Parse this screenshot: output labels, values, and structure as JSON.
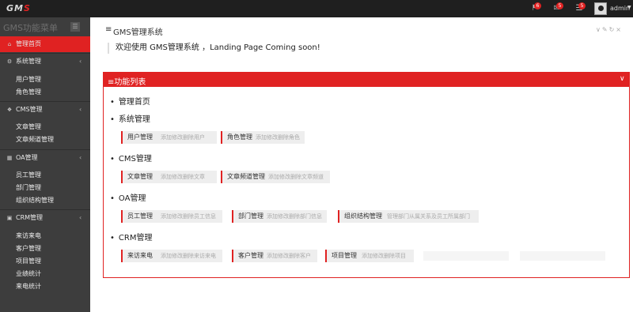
{
  "topbar": {
    "logo_main": "GM",
    "logo_accent": "S",
    "badges": [
      "6",
      "5",
      "5"
    ],
    "username": "admin"
  },
  "sidebar": {
    "menu_title": "GMS功能菜单",
    "home": "管理首页",
    "sections": [
      {
        "label": "系统管理",
        "items": [
          "用户管理",
          "角色管理"
        ]
      },
      {
        "label": "CMS管理",
        "items": [
          "文章管理",
          "文章频道管理"
        ]
      },
      {
        "label": "OA管理",
        "items": [
          "员工管理",
          "部门管理",
          "组织结构管理"
        ]
      },
      {
        "label": "CRM管理",
        "items": [
          "来访来电",
          "客户管理",
          "项目管理",
          "业绩统计",
          "来电统计"
        ]
      }
    ]
  },
  "main": {
    "panel_title": "GMS管理系统",
    "welcome": "欢迎使用 GMS管理系统 ，Landing Page Coming soon!",
    "fn_title": "功能列表",
    "groups": [
      {
        "title": "管理首页",
        "cards": []
      },
      {
        "title": "系统管理",
        "cards": [
          {
            "name": "用户管理",
            "desc": "添加修改删除用户"
          },
          {
            "name": "角色管理",
            "desc": "添加修改删除角色"
          }
        ]
      },
      {
        "title": "CMS管理",
        "cards": [
          {
            "name": "文章管理",
            "desc": "添加修改删除文章"
          },
          {
            "name": "文章频道管理",
            "desc": "添加修改删除文章频道"
          }
        ]
      },
      {
        "title": "OA管理",
        "cards": [
          {
            "name": "员工管理",
            "desc": "添加修改删除员工信息"
          },
          {
            "name": "部门管理",
            "desc": "添加修改删除部门信息"
          },
          {
            "name": "组织结构管理",
            "desc": "管理部门从属关系及员工所属部门"
          }
        ]
      },
      {
        "title": "CRM管理",
        "cards": [
          {
            "name": "来访来电",
            "desc": "添加修改删除来访来电"
          },
          {
            "name": "客户管理",
            "desc": "添加修改删除客户"
          },
          {
            "name": "项目管理",
            "desc": "添加修改删除项目"
          }
        ]
      }
    ]
  },
  "icons": {
    "home": "home-icon",
    "system": "gear-icon",
    "cms": "leaf-icon",
    "oa": "org-icon",
    "crm": "card-icon",
    "bell": "bell-icon",
    "mail": "envelope-icon",
    "tasks": "tasks-icon"
  },
  "colors": {
    "accent": "#e02222",
    "sidebar": "#3d3d3d",
    "topbar": "#1f1f1f"
  }
}
